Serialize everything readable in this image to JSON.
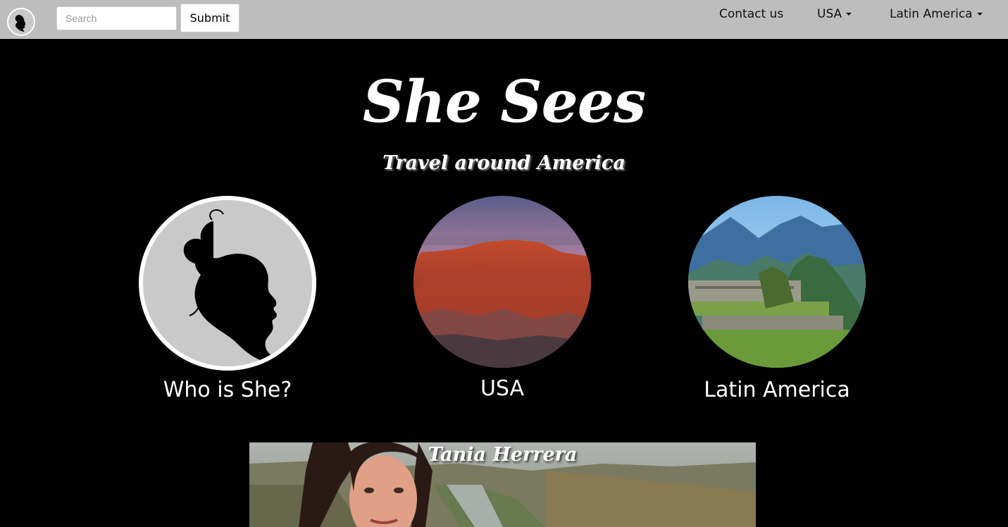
{
  "nav": {
    "logo_icon": "woman-silhouette-icon",
    "search_placeholder": "Search",
    "submit_label": "Submit",
    "links": [
      {
        "label": "Contact us",
        "has_caret": false
      },
      {
        "label": "USA",
        "has_caret": true
      },
      {
        "label": "Latin America",
        "has_caret": true
      }
    ]
  },
  "hero": {
    "title": "She Sees",
    "subtitle": "Travel around America"
  },
  "cards": [
    {
      "label": "Who is She?",
      "image": "woman-silhouette-icon"
    },
    {
      "label": "USA",
      "image": "grand-canyon-photo"
    },
    {
      "label": "Latin America",
      "image": "machu-picchu-photo"
    }
  ],
  "feature": {
    "name": "Tania Herrera",
    "image": "tania-herrera-photo"
  },
  "colors": {
    "navbar_bg": "#bdbdbe",
    "page_bg": "#000000",
    "silhouette_bg": "#c9c9c9",
    "text": "#ffffff"
  }
}
